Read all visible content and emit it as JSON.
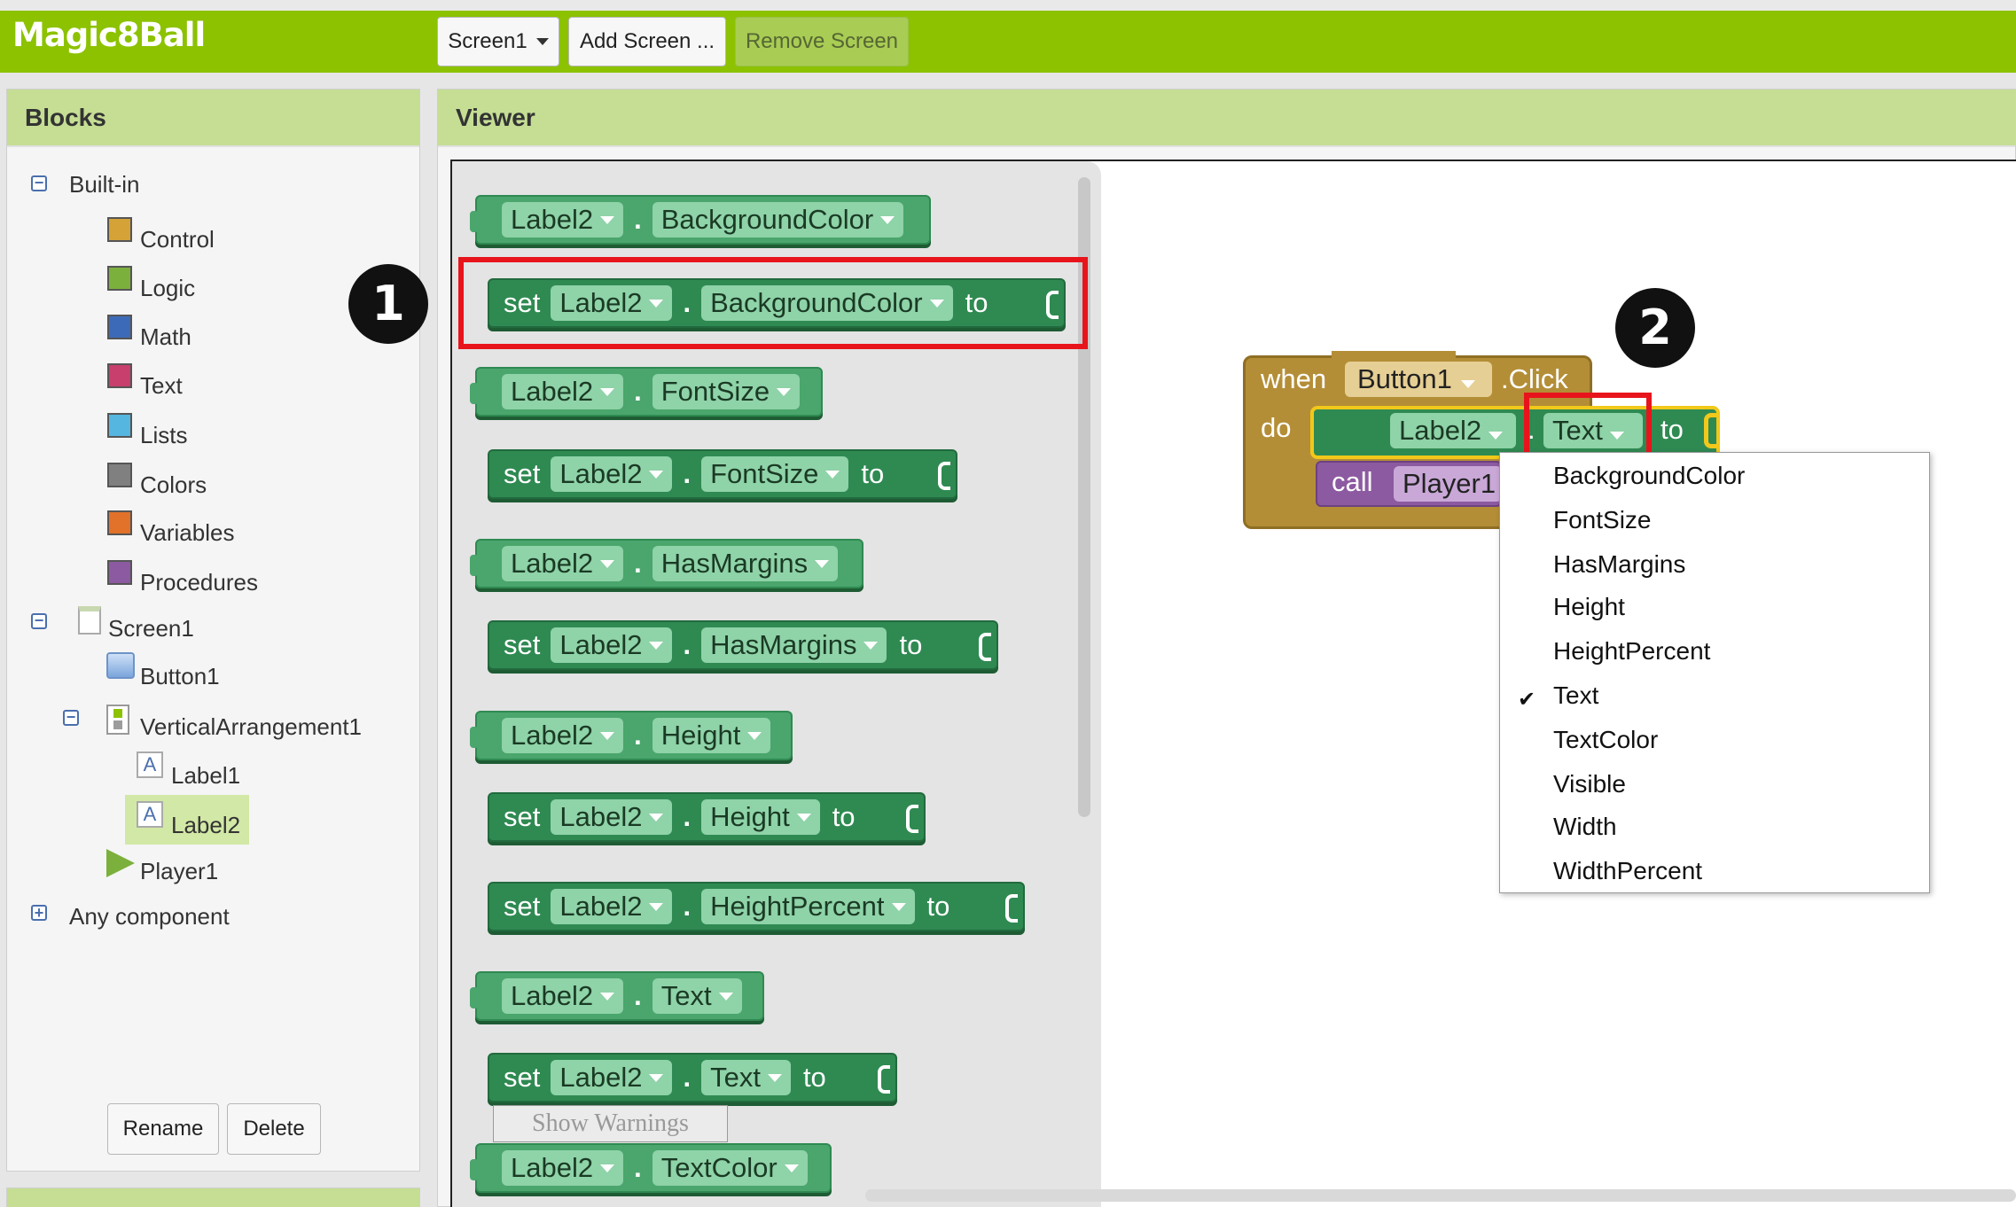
{
  "app_title": "Magic8Ball",
  "toolbar": {
    "screen_label": "Screen1",
    "add_screen_label": "Add Screen ...",
    "remove_screen_label": "Remove Screen"
  },
  "blocks_panel": {
    "title": "Blocks",
    "builtin_label": "Built-in",
    "builtin": [
      {
        "label": "Control",
        "color": "#d4a236"
      },
      {
        "label": "Logic",
        "color": "#7bb03c"
      },
      {
        "label": "Math",
        "color": "#3d6ab8"
      },
      {
        "label": "Text",
        "color": "#c83e6c"
      },
      {
        "label": "Lists",
        "color": "#55b6e0"
      },
      {
        "label": "Colors",
        "color": "#808080"
      },
      {
        "label": "Variables",
        "color": "#e2712a"
      },
      {
        "label": "Procedures",
        "color": "#8c5aa0"
      }
    ],
    "components": {
      "screen": "Screen1",
      "button": "Button1",
      "arrangement": "VerticalArrangement1",
      "label1": "Label1",
      "label2": "Label2",
      "player": "Player1"
    },
    "any_component": "Any component",
    "rename_label": "Rename",
    "delete_label": "Delete"
  },
  "viewer": {
    "title": "Viewer",
    "show_warnings": "Show Warnings",
    "component": "Label2",
    "set_kw": "set",
    "to_kw": "to",
    "dot": ".",
    "drawer_props": [
      "BackgroundColor",
      "FontSize",
      "HasMargins",
      "Height",
      "HeightPercent",
      "Text",
      "TextColor"
    ],
    "event_block": {
      "when_kw": "when",
      "component": "Button1",
      "event": ".Click",
      "do_kw": "do",
      "set_component": "Label2",
      "set_property": "Text",
      "call_kw": "call",
      "call_component": "Player1"
    },
    "dropdown_options": [
      "BackgroundColor",
      "FontSize",
      "HasMargins",
      "Height",
      "HeightPercent",
      "Text",
      "TextColor",
      "Visible",
      "Width",
      "WidthPercent"
    ],
    "dropdown_selected": "Text",
    "callouts": [
      "1",
      "2"
    ],
    "highlight_color": "#e8141c"
  }
}
